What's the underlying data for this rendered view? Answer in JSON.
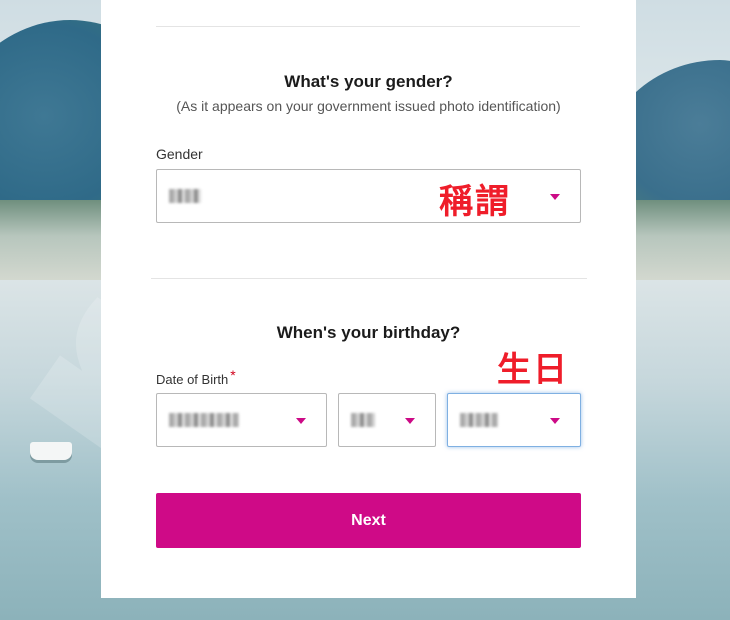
{
  "gender_section": {
    "heading": "What's your gender?",
    "subheading": "(As it appears on your government issued photo identification)",
    "label": "Gender",
    "annotation": "稱謂"
  },
  "birthday_section": {
    "heading": "When's your birthday?",
    "label": "Date of Birth",
    "required_mark": "*",
    "annotation": "生日"
  },
  "next_button": {
    "label": "Next"
  },
  "colors": {
    "accent": "#cf0a87",
    "annotation_red": "#ef1d2a",
    "required_red": "#d0021b"
  }
}
